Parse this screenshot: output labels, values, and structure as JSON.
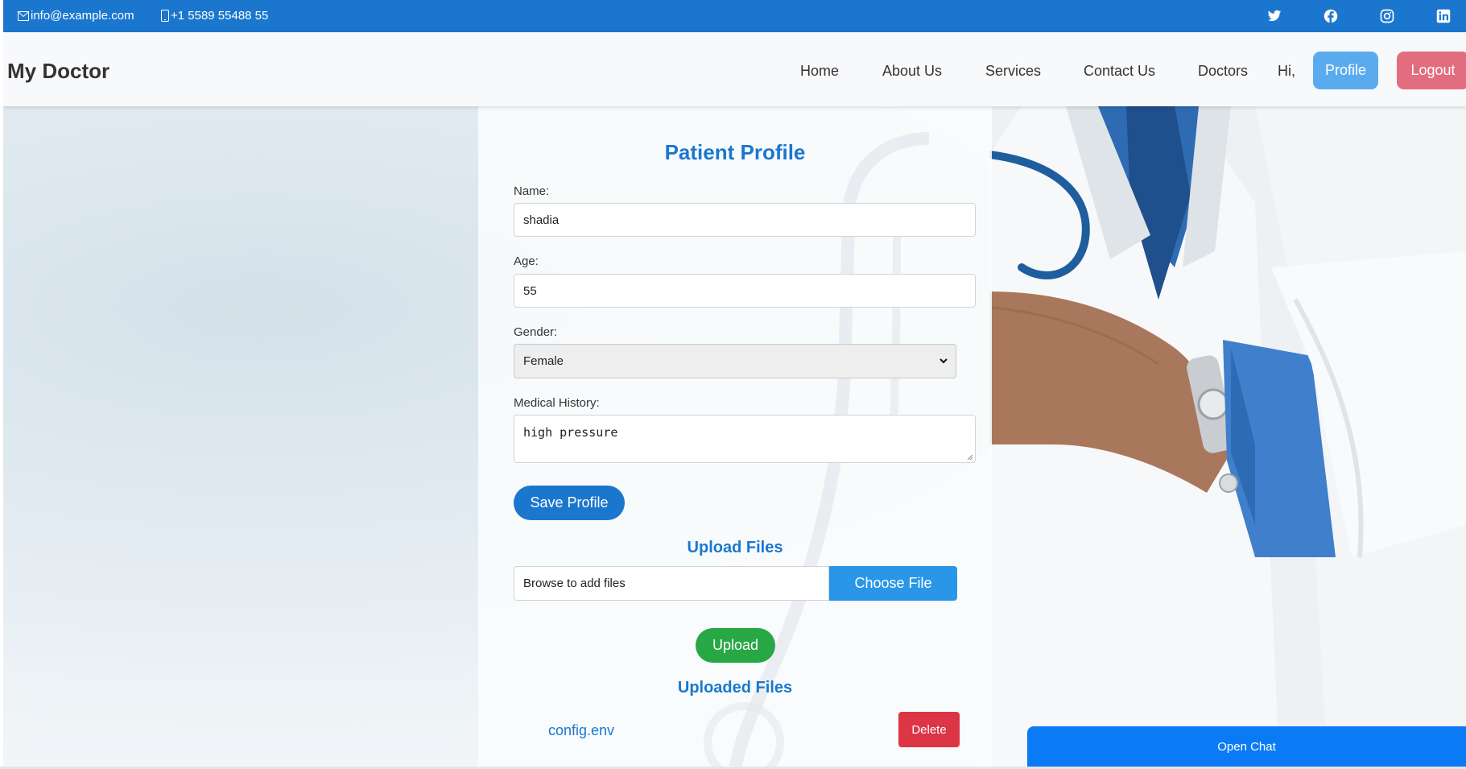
{
  "topbar": {
    "email": "info@example.com",
    "phone": "+1 5589 55488 55",
    "socials": [
      "twitter-icon",
      "facebook-icon",
      "instagram-icon",
      "linkedin-icon"
    ]
  },
  "navbar": {
    "brand": "My Doctor",
    "links": [
      "Home",
      "About Us",
      "Services",
      "Contact Us",
      "Doctors"
    ],
    "greeting": "Hi,",
    "profile_label": "Profile",
    "logout_label": "Logout"
  },
  "form": {
    "title": "Patient Profile",
    "name_label": "Name:",
    "name_value": "shadia",
    "age_label": "Age:",
    "age_value": "55",
    "gender_label": "Gender:",
    "gender_value": "Female",
    "history_label": "Medical History:",
    "history_value": "high pressure",
    "save_label": "Save Profile"
  },
  "upload": {
    "title": "Upload Files",
    "file_placeholder": "Browse to add files",
    "choose_label": "Choose File",
    "upload_label": "Upload"
  },
  "uploaded": {
    "title": "Uploaded Files",
    "files": [
      {
        "name": "config.env",
        "delete_label": "Delete"
      }
    ]
  },
  "chat": {
    "label": "Open Chat"
  },
  "colors": {
    "primary": "#1b77ce",
    "profile_button": "#5aabee",
    "logout_button": "#e26d7f",
    "upload_button": "#28a745",
    "delete_button": "#dc3545",
    "chat_button": "#0b7bf5"
  }
}
